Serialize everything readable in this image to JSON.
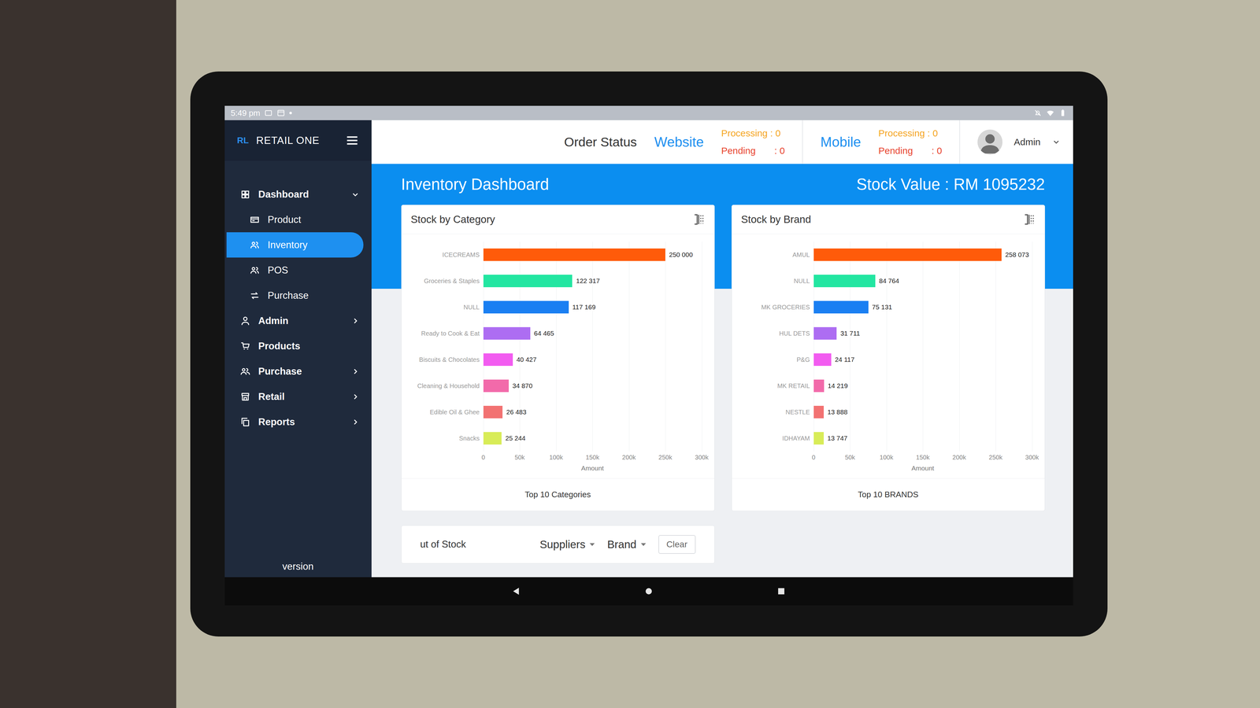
{
  "status_bar": {
    "time": "5:49 pm"
  },
  "app": {
    "logo": "RL",
    "name": "RETAIL ONE"
  },
  "sidebar": {
    "items": [
      {
        "label": "Dashboard",
        "kind": "parent",
        "expanded": true,
        "selected": false
      },
      {
        "label": "Product",
        "kind": "child",
        "expanded": false,
        "selected": false
      },
      {
        "label": "Inventory",
        "kind": "child",
        "expanded": false,
        "selected": true
      },
      {
        "label": "POS",
        "kind": "child",
        "expanded": false,
        "selected": false
      },
      {
        "label": "Purchase",
        "kind": "child",
        "expanded": false,
        "selected": false
      },
      {
        "label": "Admin",
        "kind": "parent",
        "expanded": false,
        "selected": false
      },
      {
        "label": "Products",
        "kind": "link",
        "expanded": false,
        "selected": false
      },
      {
        "label": "Purchase",
        "kind": "parent",
        "expanded": false,
        "selected": false
      },
      {
        "label": "Retail",
        "kind": "parent",
        "expanded": false,
        "selected": false
      },
      {
        "label": "Reports",
        "kind": "parent",
        "expanded": false,
        "selected": false
      }
    ],
    "footer": "version"
  },
  "topbar": {
    "title": "Order Status",
    "channels": [
      {
        "name": "Website",
        "processing": "Processing : 0",
        "pending_label": "Pending",
        "pending_value": ": 0"
      },
      {
        "name": "Mobile",
        "processing": "Processing : 0",
        "pending_label": "Pending",
        "pending_value": ": 0"
      }
    ],
    "user": "Admin"
  },
  "dashboard": {
    "title": "Inventory Dashboard",
    "stock_value": "Stock Value : RM 1095232"
  },
  "charts": [
    {
      "title": "Stock by Category",
      "footer": "Top 10 Categories",
      "axis_title": "Amount",
      "ticks": [
        "0",
        "50k",
        "100k",
        "150k",
        "200k",
        "250k",
        "300k"
      ],
      "tick_values": [
        0,
        50000,
        100000,
        150000,
        200000,
        250000,
        300000
      ],
      "bars": [
        {
          "label": "ICECREAMS",
          "value": 250000,
          "value_label": "250 000",
          "color": "#ff5b0a"
        },
        {
          "label": "Groceries & Staples",
          "value": 122317,
          "value_label": "122 317",
          "color": "#23e6a1"
        },
        {
          "label": "NULL",
          "value": 117169,
          "value_label": "117 169",
          "color": "#1a7ff2"
        },
        {
          "label": "Ready to Cook & Eat",
          "value": 64465,
          "value_label": "64 465",
          "color": "#ad6df2"
        },
        {
          "label": "Biscuits & Chocolates",
          "value": 40427,
          "value_label": "40 427",
          "color": "#f25cf0"
        },
        {
          "label": "Cleaning & Household",
          "value": 34870,
          "value_label": "34 870",
          "color": "#f26aaa"
        },
        {
          "label": "Edible Oil & Ghee",
          "value": 26483,
          "value_label": "26 483",
          "color": "#f27272"
        },
        {
          "label": "Snacks",
          "value": 25244,
          "value_label": "25 244",
          "color": "#d8ec58"
        }
      ]
    },
    {
      "title": "Stock by Brand",
      "footer": "Top 10 BRANDS",
      "axis_title": "Amount",
      "ticks": [
        "0",
        "50k",
        "100k",
        "150k",
        "200k",
        "250k",
        "300k"
      ],
      "tick_values": [
        0,
        50000,
        100000,
        150000,
        200000,
        250000,
        300000
      ],
      "bars": [
        {
          "label": "AMUL",
          "value": 258073,
          "value_label": "258 073",
          "color": "#ff5b0a"
        },
        {
          "label": "NULL",
          "value": 84764,
          "value_label": "84 764",
          "color": "#23e6a1"
        },
        {
          "label": "MK GROCERIES",
          "value": 75131,
          "value_label": "75 131",
          "color": "#1a7ff2"
        },
        {
          "label": "HUL DETS",
          "value": 31711,
          "value_label": "31 711",
          "color": "#ad6df2"
        },
        {
          "label": "P&G",
          "value": 24117,
          "value_label": "24 117",
          "color": "#f25cf0"
        },
        {
          "label": "MK RETAIL",
          "value": 14219,
          "value_label": "14 219",
          "color": "#f26aaa"
        },
        {
          "label": "NESTLE",
          "value": 13888,
          "value_label": "13 888",
          "color": "#f27272"
        },
        {
          "label": "IDHAYAM",
          "value": 13747,
          "value_label": "13 747",
          "color": "#d8ec58"
        }
      ]
    }
  ],
  "out_of_stock": {
    "title": "ut of Stock",
    "filters": [
      "Suppliers",
      "Brand"
    ],
    "clear": "Clear"
  }
}
